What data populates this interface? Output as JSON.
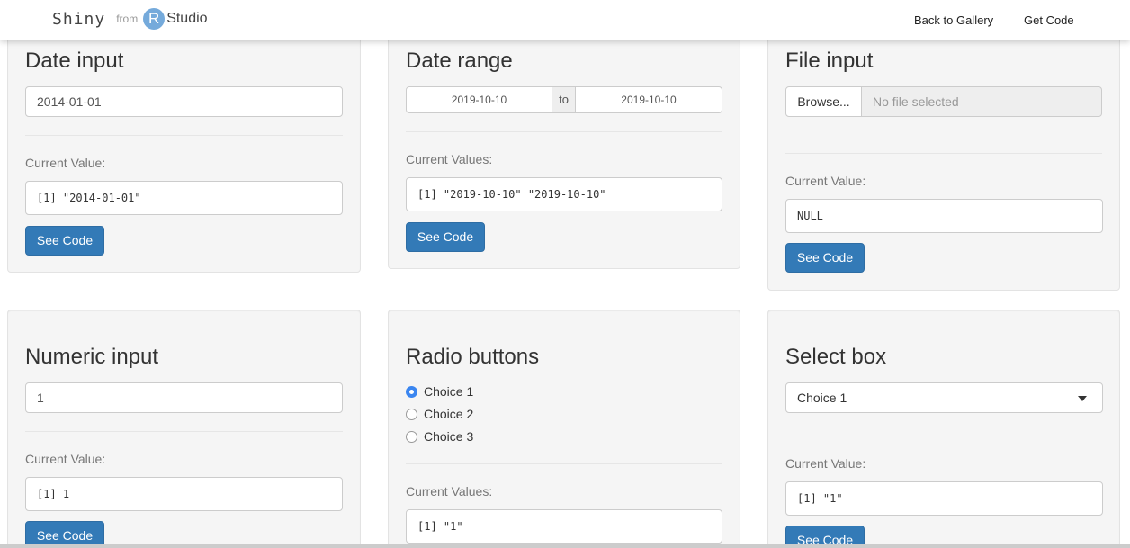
{
  "navbar": {
    "brand_shiny": "Shiny",
    "brand_from": "from",
    "brand_r": "R",
    "brand_studio": "Studio",
    "links": [
      "Back to Gallery",
      "Get Code"
    ]
  },
  "common": {
    "current_value_label": "Current Value:",
    "current_values_label": "Current Values:",
    "see_code": "See Code"
  },
  "date_input": {
    "title": "Date input",
    "value": "2014-01-01",
    "output": "[1] \"2014-01-01\""
  },
  "date_range": {
    "title": "Date range",
    "start": "2019-10-10",
    "separator": "to",
    "end": "2019-10-10",
    "output": "[1] \"2019-10-10\" \"2019-10-10\""
  },
  "file_input": {
    "title": "File input",
    "browse": "Browse...",
    "placeholder": "No file selected",
    "output": "NULL"
  },
  "numeric_input": {
    "title": "Numeric input",
    "value": "1",
    "output": "[1] 1"
  },
  "radio_buttons": {
    "title": "Radio buttons",
    "choices": [
      "Choice 1",
      "Choice 2",
      "Choice 3"
    ],
    "selected": "Choice 1",
    "output": "[1] \"1\""
  },
  "select_box": {
    "title": "Select box",
    "selected": "Choice 1",
    "output": "[1] \"1\""
  },
  "colors": {
    "primary_button": "#337ab7",
    "radio_selected": "#3b86f0",
    "well_background": "#f5f5f5"
  }
}
